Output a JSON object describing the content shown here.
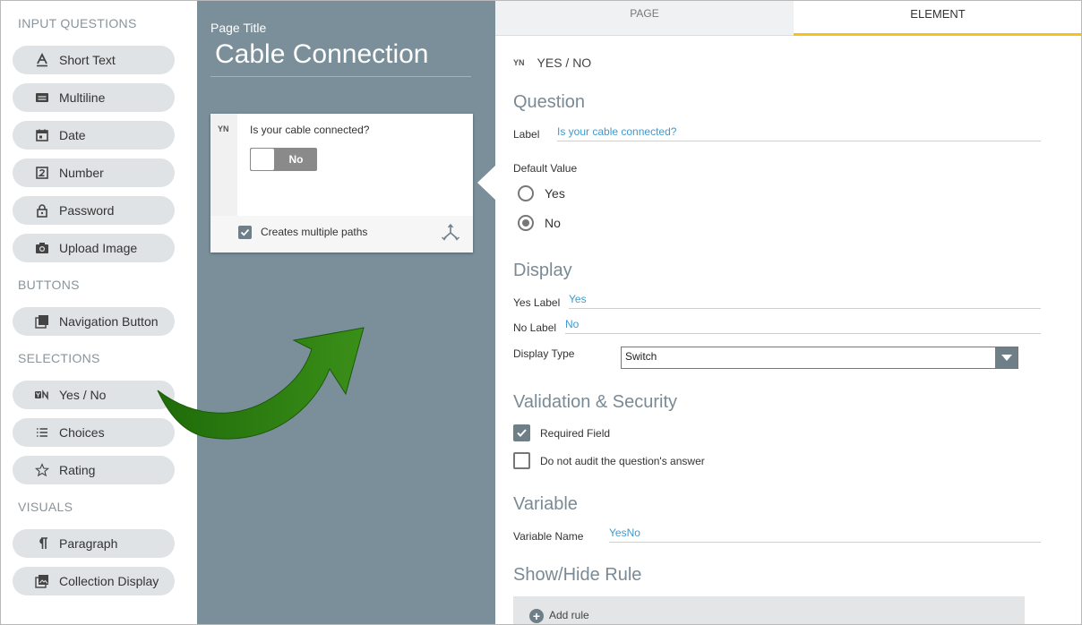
{
  "sidebar": {
    "sections": [
      {
        "title": "INPUT QUESTIONS",
        "items": [
          {
            "label": "Short Text",
            "icon": "text-a-icon"
          },
          {
            "label": "Multiline",
            "icon": "multiline-icon"
          },
          {
            "label": "Date",
            "icon": "calendar-icon"
          },
          {
            "label": "Number",
            "icon": "number-icon"
          },
          {
            "label": "Password",
            "icon": "lock-icon"
          },
          {
            "label": "Upload Image",
            "icon": "camera-icon"
          }
        ]
      },
      {
        "title": "BUTTONS",
        "items": [
          {
            "label": "Navigation Button",
            "icon": "stack-icon"
          }
        ]
      },
      {
        "title": "SELECTIONS",
        "items": [
          {
            "label": "Yes / No",
            "icon": "yes-no-icon"
          },
          {
            "label": "Choices",
            "icon": "list-icon"
          },
          {
            "label": "Rating",
            "icon": "star-icon"
          }
        ]
      },
      {
        "title": "VISUALS",
        "items": [
          {
            "label": "Paragraph",
            "icon": "paragraph-icon"
          },
          {
            "label": "Collection Display",
            "icon": "image-collection-icon"
          }
        ]
      }
    ]
  },
  "canvas": {
    "page_title_label": "Page Title",
    "page_title": "Cable Connection",
    "card": {
      "badge": "YN",
      "question": "Is your cable connected?",
      "switch_value": "No",
      "multiple_paths_label": "Creates multiple paths",
      "multiple_paths_checked": true
    }
  },
  "panel": {
    "tabs": [
      {
        "label": "PAGE"
      },
      {
        "label": "ELEMENT",
        "active": true
      }
    ],
    "element_badge": "YN",
    "element_type": "YES / NO",
    "question": {
      "heading": "Question",
      "label_label": "Label",
      "label_value": "Is your cable connected?",
      "default_value_label": "Default Value",
      "options": [
        {
          "label": "Yes",
          "selected": false
        },
        {
          "label": "No",
          "selected": true
        }
      ]
    },
    "display": {
      "heading": "Display",
      "yes_label_label": "Yes Label",
      "yes_label_value": "Yes",
      "no_label_label": "No Label",
      "no_label_value": "No",
      "display_type_label": "Display Type",
      "display_type_value": "Switch"
    },
    "validation": {
      "heading": "Validation & Security",
      "required_label": "Required Field",
      "required_checked": true,
      "no_audit_label": "Do not audit the question's answer",
      "no_audit_checked": false
    },
    "variable": {
      "heading": "Variable",
      "name_label": "Variable Name",
      "name_value": "YesNo"
    },
    "rule": {
      "heading": "Show/Hide Rule",
      "add_label": "Add rule"
    }
  },
  "colors": {
    "canvas_bg": "#7a8f9a",
    "pill_bg": "#dfe3e5",
    "accent_yellow": "#f2c31b",
    "link_blue": "#3d9ad1",
    "arrow_green": "#2e7d12"
  }
}
